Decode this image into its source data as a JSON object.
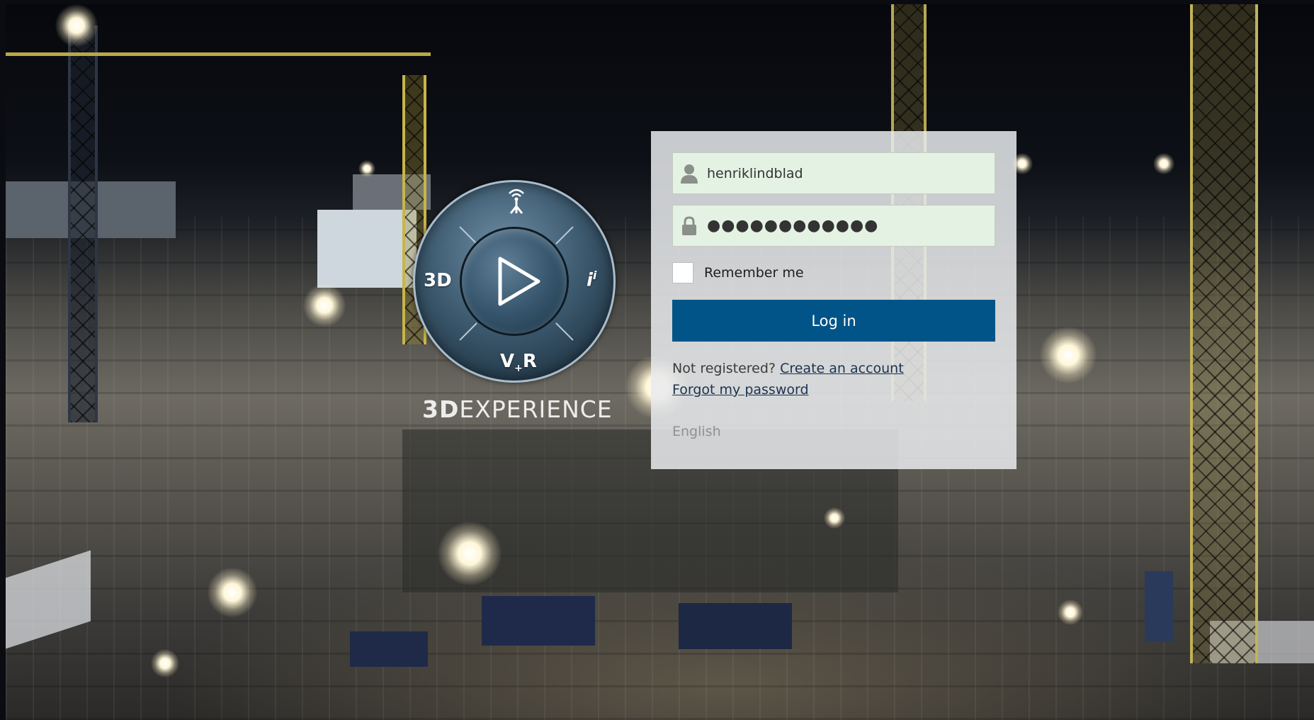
{
  "login": {
    "username": "henriklindblad",
    "password_mask": "●●●●●●●●●●●●",
    "remember_label": "Remember me",
    "login_label": "Log in",
    "not_registered": "Not registered?",
    "create_account": "Create an account",
    "forgot_password": "Forgot my password",
    "language": "English"
  },
  "logo": {
    "left_label": "3D",
    "right_label": "i",
    "right_sup": "i",
    "bottom_label": "V",
    "bottom_sub": "+",
    "bottom_label_end": "R",
    "brand_bold": "3D",
    "brand_rest": "EXPERIENCE"
  },
  "colors": {
    "login_button": "#005487",
    "field_background": "#e4f2e3",
    "card_background": "#e8eaec"
  },
  "icons": {
    "user": "user-icon",
    "lock": "lock-icon",
    "play": "play-icon",
    "network": "antenna-icon"
  }
}
